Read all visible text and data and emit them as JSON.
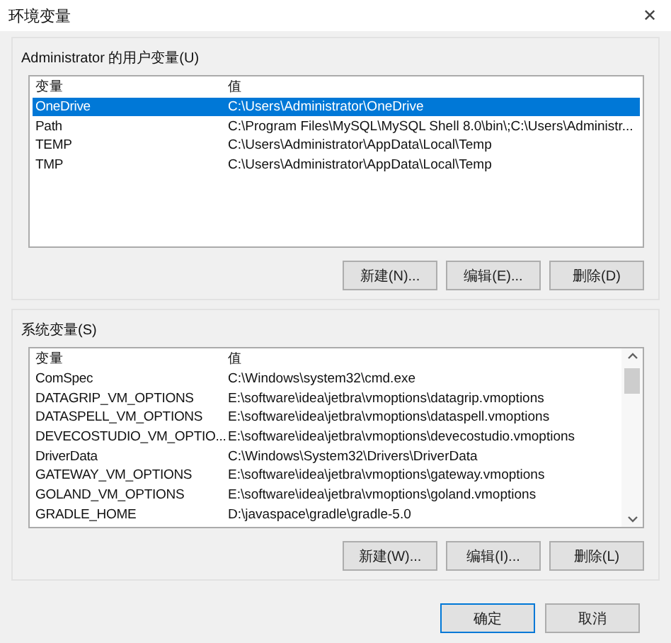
{
  "window": {
    "title": "环境变量",
    "close": "✕"
  },
  "user_variables": {
    "label": "Administrator 的用户变量(U)",
    "columns": [
      "变量",
      "值"
    ],
    "rows": [
      {
        "name": "OneDrive",
        "value": "C:\\Users\\Administrator\\OneDrive",
        "selected": true
      },
      {
        "name": "Path",
        "value": "C:\\Program Files\\MySQL\\MySQL Shell 8.0\\bin\\;C:\\Users\\Administr...",
        "selected": false
      },
      {
        "name": "TEMP",
        "value": "C:\\Users\\Administrator\\AppData\\Local\\Temp",
        "selected": false
      },
      {
        "name": "TMP",
        "value": "C:\\Users\\Administrator\\AppData\\Local\\Temp",
        "selected": false
      }
    ],
    "buttons": [
      "新建(N)...",
      "编辑(E)...",
      "删除(D)"
    ]
  },
  "system_variables": {
    "label": "系统变量(S)",
    "columns": [
      "变量",
      "值"
    ],
    "rows": [
      {
        "name": "ComSpec",
        "value": "C:\\Windows\\system32\\cmd.exe",
        "selected": false
      },
      {
        "name": "DATAGRIP_VM_OPTIONS",
        "value": "E:\\software\\idea\\jetbra\\vmoptions\\datagrip.vmoptions",
        "selected": false
      },
      {
        "name": "DATASPELL_VM_OPTIONS",
        "value": "E:\\software\\idea\\jetbra\\vmoptions\\dataspell.vmoptions",
        "selected": false
      },
      {
        "name": "DEVECOSTUDIO_VM_OPTIO...",
        "value": "E:\\software\\idea\\jetbra\\vmoptions\\devecostudio.vmoptions",
        "selected": false
      },
      {
        "name": "DriverData",
        "value": "C:\\Windows\\System32\\Drivers\\DriverData",
        "selected": false
      },
      {
        "name": "GATEWAY_VM_OPTIONS",
        "value": "E:\\software\\idea\\jetbra\\vmoptions\\gateway.vmoptions",
        "selected": false
      },
      {
        "name": "GOLAND_VM_OPTIONS",
        "value": "E:\\software\\idea\\jetbra\\vmoptions\\goland.vmoptions",
        "selected": false
      },
      {
        "name": "GRADLE_HOME",
        "value": "D:\\javaspace\\gradle\\gradle-5.0",
        "selected": false
      }
    ],
    "buttons": [
      "新建(W)...",
      "编辑(I)...",
      "删除(L)"
    ]
  },
  "dialog_buttons": [
    {
      "label": "确定",
      "default": true
    },
    {
      "label": "取消",
      "default": false
    }
  ]
}
